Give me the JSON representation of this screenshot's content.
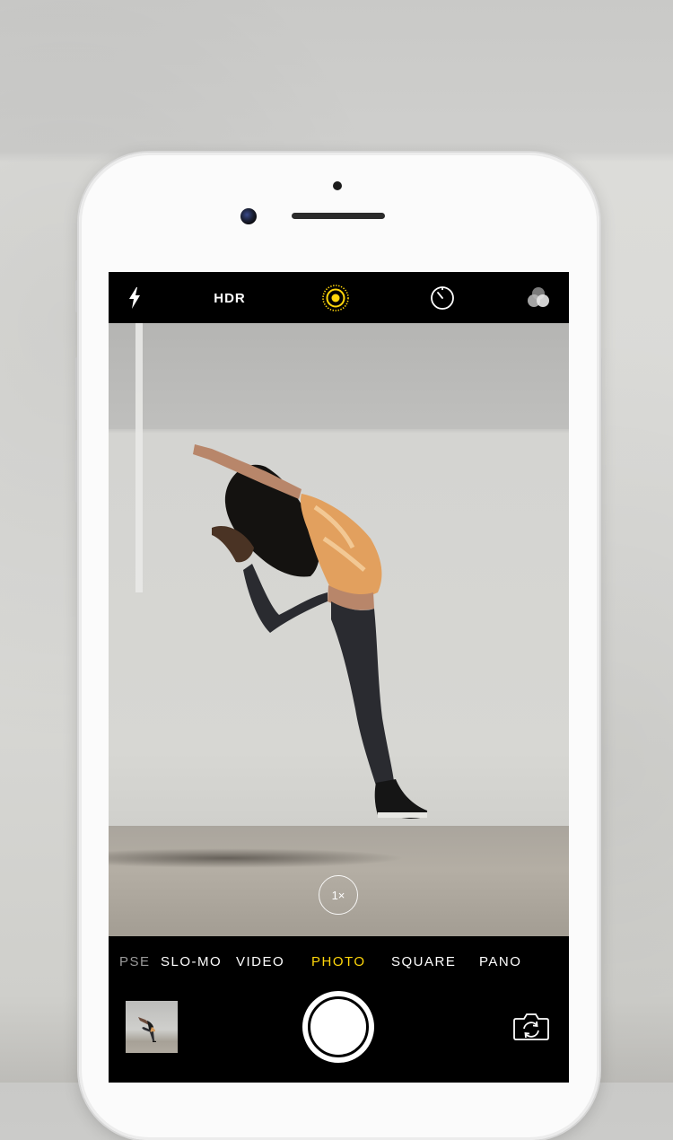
{
  "top_bar": {
    "flash_icon": "lightning-bolt",
    "hdr_label": "HDR",
    "live_icon": "live-photo",
    "timer_icon": "timer",
    "filters_icon": "filters",
    "accent_color": "#ffd60a"
  },
  "viewfinder": {
    "zoom_label": "1×"
  },
  "modes": {
    "items": [
      "PSE",
      "SLO-MO",
      "VIDEO",
      "PHOTO",
      "SQUARE",
      "PANO"
    ],
    "selected": "PHOTO"
  },
  "bottom_bar": {
    "thumbnail": "last-photo-thumbnail",
    "shutter": "shutter-button",
    "flip_icon": "switch-camera"
  }
}
